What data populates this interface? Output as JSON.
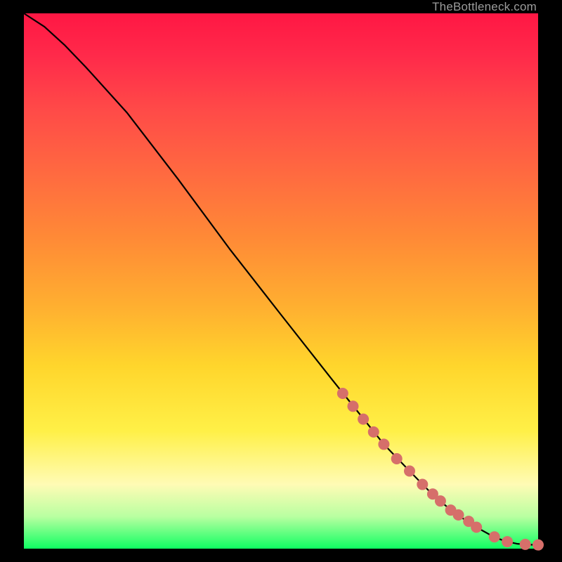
{
  "watermark": "TheBottleneck.com",
  "colors": {
    "background_black": "#000000",
    "curve": "#000000",
    "marker": "#d66f6a",
    "gradient_stops": [
      "#ff1744",
      "#ff2a4a",
      "#ff4a48",
      "#ff6a40",
      "#ff8a36",
      "#ffb030",
      "#ffd62c",
      "#fff047",
      "#fffbb5",
      "#b9ffa1",
      "#0fff62"
    ]
  },
  "chart_data": {
    "type": "line",
    "title": "",
    "xlabel": "",
    "ylabel": "",
    "xlim": [
      0,
      100
    ],
    "ylim": [
      0,
      100
    ],
    "grid": false,
    "legend": false,
    "series": [
      {
        "name": "curve",
        "x": [
          0,
          4,
          8,
          12,
          20,
          30,
          40,
          50,
          60,
          70,
          75,
          80,
          84,
          88,
          91,
          93,
          94.5,
          96,
          98,
          100
        ],
        "y": [
          100,
          97.5,
          94,
          90,
          81.5,
          69,
          56,
          43.7,
          31.5,
          19.5,
          14.5,
          9.6,
          6.5,
          4.0,
          2.4,
          1.6,
          1.2,
          0.9,
          0.75,
          0.7
        ]
      }
    ],
    "markers": {
      "name": "highlighted-points",
      "color": "#d66f6a",
      "radius_px": 8,
      "x": [
        62,
        64,
        66,
        68,
        70,
        72.5,
        75,
        77.5,
        79.5,
        81,
        83,
        84.5,
        86.5,
        88,
        91.5,
        94,
        97.5,
        100
      ],
      "y": [
        29.0,
        26.6,
        24.2,
        21.8,
        19.5,
        16.8,
        14.5,
        12.0,
        10.2,
        8.9,
        7.2,
        6.3,
        5.1,
        4.0,
        2.2,
        1.3,
        0.8,
        0.7
      ]
    }
  }
}
